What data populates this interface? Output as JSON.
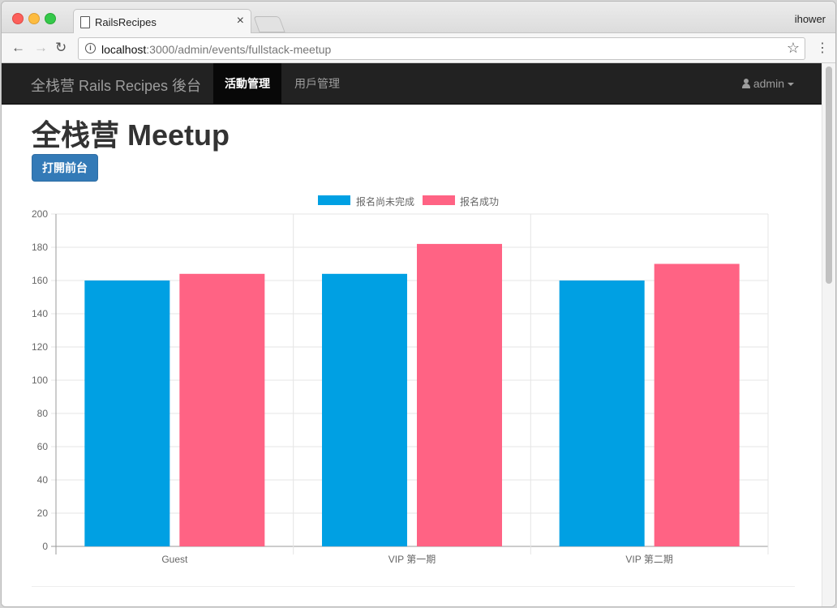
{
  "browser": {
    "tab_title": "RailsRecipes",
    "tab_close": "×",
    "profile_name": "ihower",
    "url_host": "localhost",
    "url_path": ":3000/admin/events/fullstack-meetup",
    "back_glyph": "←",
    "forward_glyph": "→",
    "reload_glyph": "↻",
    "star_glyph": "☆",
    "menu_glyph": "⋮",
    "info_glyph": "i"
  },
  "navbar": {
    "brand": "全栈营 Rails Recipes 後台",
    "items": [
      {
        "label": "活動管理",
        "active": true
      },
      {
        "label": "用戶管理",
        "active": false
      }
    ],
    "user_menu": "admin"
  },
  "main": {
    "title": "全栈营 Meetup",
    "open_frontend_button": "打開前台"
  },
  "colors": {
    "series_pending": "#00a0e3",
    "series_success": "#ff6384",
    "primary_button": "#337ab7",
    "navbar_bg": "#222222"
  },
  "chart_data": {
    "type": "bar",
    "categories": [
      "Guest",
      "VIP 第一期",
      "VIP 第二期"
    ],
    "series": [
      {
        "name": "报名尚未完成",
        "values": [
          160,
          164,
          160
        ]
      },
      {
        "name": "报名成功",
        "values": [
          164,
          182,
          170
        ]
      }
    ],
    "ylim": [
      0,
      200
    ],
    "yticks": [
      0,
      20,
      40,
      60,
      80,
      100,
      120,
      140,
      160,
      180,
      200
    ],
    "grid": true,
    "legend": "top-center"
  }
}
